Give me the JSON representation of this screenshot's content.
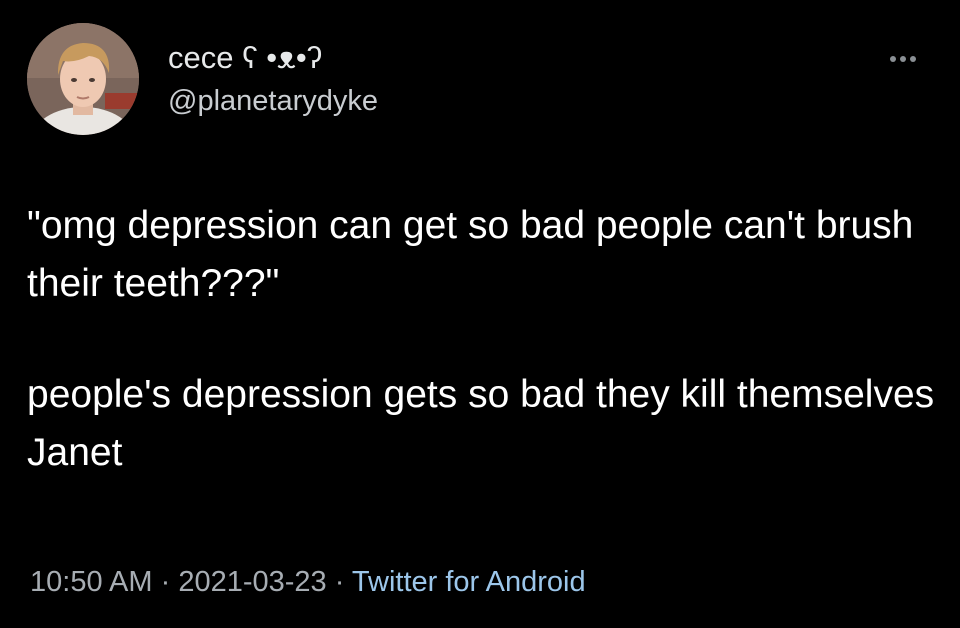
{
  "tweet": {
    "author": {
      "display_name": "cece ʕ •ᴥ•ʔ",
      "handle": "@planetarydyke",
      "avatar_icon": "profile-photo"
    },
    "more_icon": "ellipsis-icon",
    "text_paragraphs": [
      "\"omg depression can get so bad people can't brush their teeth???\"",
      "people's depression gets so bad they kill themselves Janet"
    ],
    "time": "10:50 AM",
    "separator": " · ",
    "date": "2021-03-23",
    "source": "Twitter for Android"
  },
  "colors": {
    "background": "#000000",
    "text_primary": "#ffffff",
    "text_secondary": "#a7adb3",
    "link": "#9cc6ea"
  }
}
